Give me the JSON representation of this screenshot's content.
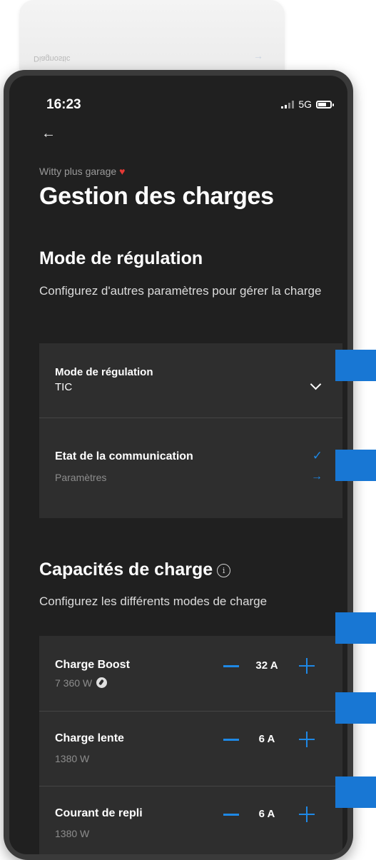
{
  "background_card": {
    "text": "Diagnostic"
  },
  "status_bar": {
    "time": "16:23",
    "network": "5G"
  },
  "header": {
    "subtitle": "Witty plus garage",
    "title": "Gestion des charges"
  },
  "regulation": {
    "title": "Mode de régulation",
    "description": "Configurez d'autres paramètres pour gérer la charge",
    "mode_label": "Mode de régulation",
    "mode_value": "TIC",
    "communication_label": "Etat de la communication",
    "settings_label": "Paramètres"
  },
  "capacities": {
    "title": "Capacités de charge",
    "description": "Configurez les différents modes de charge",
    "items": [
      {
        "name": "Charge Boost",
        "power": "7 360 W",
        "value": "32 A"
      },
      {
        "name": "Charge lente",
        "power": "1380 W",
        "value": "6 A"
      },
      {
        "name": "Courant de repli",
        "power": "1380 W",
        "value": "6 A"
      }
    ]
  },
  "colors": {
    "accent": "#1e88e5",
    "background": "#202020",
    "card": "#2e2e2e"
  },
  "icons": [
    "back-arrow-icon",
    "heart-icon",
    "chevron-down-icon",
    "check-icon",
    "arrow-right-icon",
    "info-icon",
    "compass-icon",
    "minus-icon",
    "plus-icon"
  ]
}
